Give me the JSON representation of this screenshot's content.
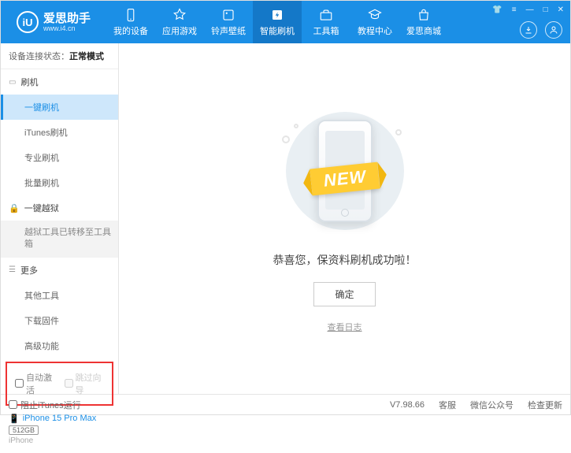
{
  "header": {
    "logo_char": "iU",
    "app_name": "爱思助手",
    "url": "www.i4.cn",
    "nav": [
      {
        "label": "我的设备"
      },
      {
        "label": "应用游戏"
      },
      {
        "label": "铃声壁纸"
      },
      {
        "label": "智能刷机"
      },
      {
        "label": "工具箱"
      },
      {
        "label": "教程中心"
      },
      {
        "label": "爱思商城"
      }
    ]
  },
  "sidebar": {
    "status_label": "设备连接状态：",
    "status_value": "正常模式",
    "group_flash": "刷机",
    "items_flash": [
      "一键刷机",
      "iTunes刷机",
      "专业刷机",
      "批量刷机"
    ],
    "group_jailbreak": "一键越狱",
    "jailbreak_note": "越狱工具已转移至工具箱",
    "group_more": "更多",
    "items_more": [
      "其他工具",
      "下载固件",
      "高级功能"
    ],
    "auto_activate": "自动激活",
    "skip_guide": "跳过向导",
    "device_name": "iPhone 15 Pro Max",
    "device_storage": "512GB",
    "device_type": "iPhone"
  },
  "main": {
    "ribbon": "NEW",
    "success": "恭喜您，保资料刷机成功啦！",
    "ok": "确定",
    "view_log": "查看日志"
  },
  "footer": {
    "block_itunes": "阻止iTunes运行",
    "version": "V7.98.66",
    "support": "客服",
    "wechat": "微信公众号",
    "check_update": "检查更新"
  }
}
